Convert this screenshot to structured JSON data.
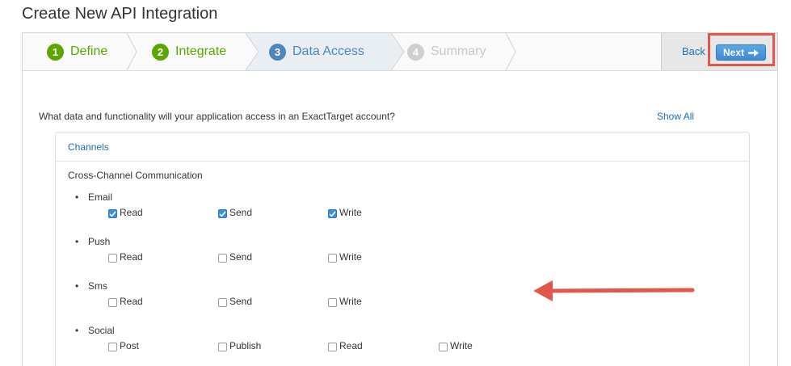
{
  "page_title": "Create New API Integration",
  "steps": [
    {
      "number": "1",
      "label": "Define",
      "state": "done"
    },
    {
      "number": "2",
      "label": "Integrate",
      "state": "done"
    },
    {
      "number": "3",
      "label": "Data Access",
      "state": "current"
    },
    {
      "number": "4",
      "label": "Summary",
      "state": "future"
    }
  ],
  "actions": {
    "back_label": "Back",
    "next_label": "Next"
  },
  "question": "What data and functionality will your application access in an ExactTarget account?",
  "show_all_label": "Show All",
  "panel": {
    "header": "Channels",
    "section_title": "Cross-Channel Communication",
    "groups": [
      {
        "name": "Email",
        "permissions": [
          {
            "label": "Read",
            "checked": true
          },
          {
            "label": "Send",
            "checked": true
          },
          {
            "label": "Write",
            "checked": true
          }
        ]
      },
      {
        "name": "Push",
        "permissions": [
          {
            "label": "Read",
            "checked": false
          },
          {
            "label": "Send",
            "checked": false
          },
          {
            "label": "Write",
            "checked": false
          }
        ]
      },
      {
        "name": "Sms",
        "permissions": [
          {
            "label": "Read",
            "checked": false
          },
          {
            "label": "Send",
            "checked": false
          },
          {
            "label": "Write",
            "checked": false
          }
        ]
      },
      {
        "name": "Social",
        "permissions": [
          {
            "label": "Post",
            "checked": false
          },
          {
            "label": "Publish",
            "checked": false
          },
          {
            "label": "Read",
            "checked": false
          },
          {
            "label": "Write",
            "checked": false
          }
        ]
      }
    ]
  },
  "colors": {
    "done": "#5aa700",
    "current": "#4d86bd",
    "future": "#c8c8c8",
    "highlight": "#e2574c",
    "link": "#1a6fb5"
  }
}
